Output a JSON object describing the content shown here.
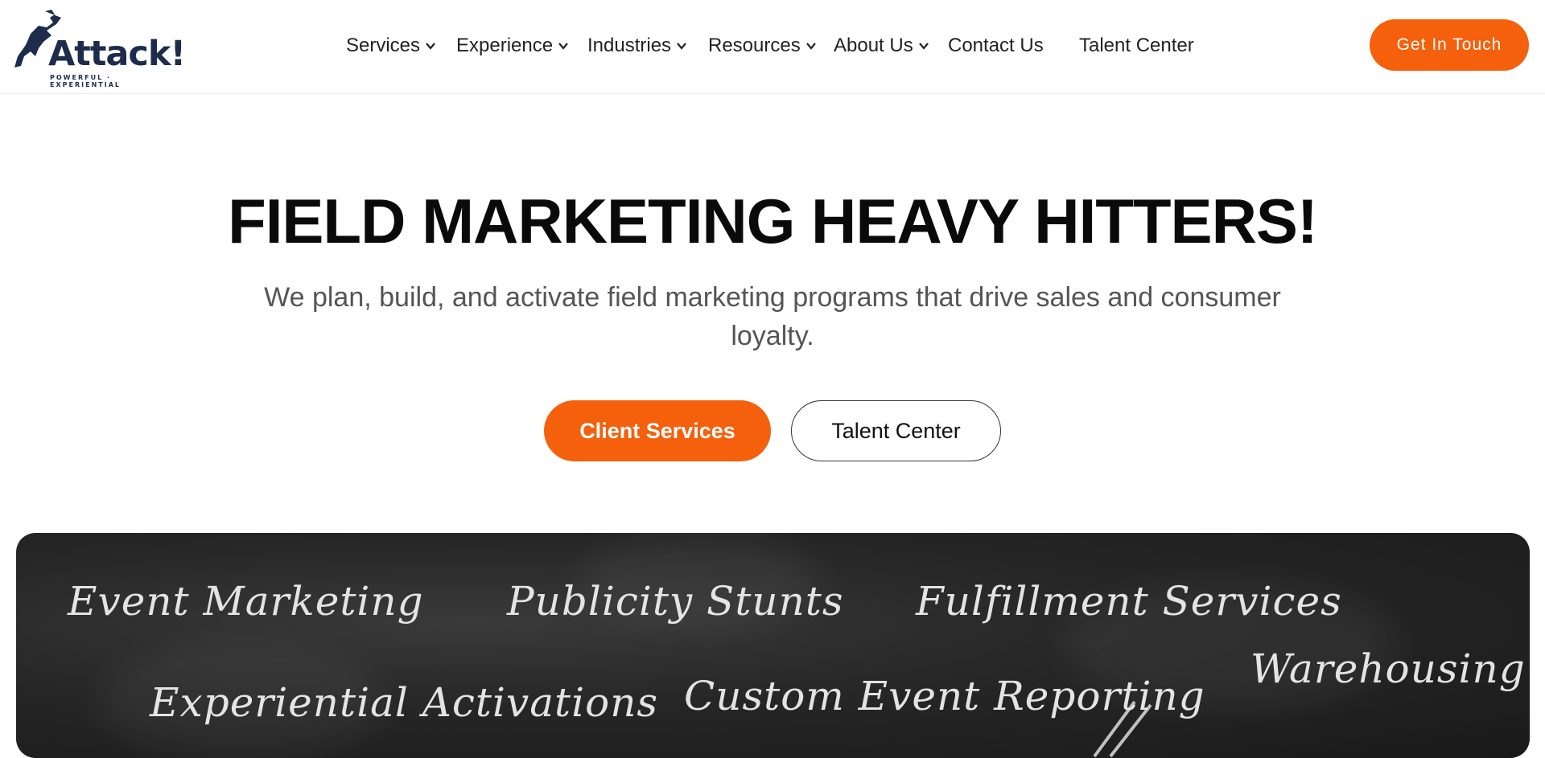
{
  "brand": {
    "name": "Attack!",
    "tagline": "POWERFUL · EXPERIENTIAL",
    "navy": "#1d2c4c",
    "accent": "#f4600c"
  },
  "nav": {
    "items": [
      {
        "label": "Services",
        "dropdown": true
      },
      {
        "label": "Experience",
        "dropdown": true
      },
      {
        "label": "Industries",
        "dropdown": true
      },
      {
        "label": "Resources",
        "dropdown": true
      },
      {
        "label": "About Us",
        "dropdown": true
      },
      {
        "label": "Contact Us",
        "dropdown": false
      },
      {
        "label": "Talent Center",
        "dropdown": false
      }
    ],
    "cta_label": "Get In Touch"
  },
  "hero": {
    "title": "FIELD MARKETING HEAVY HITTERS!",
    "subtitle": "We plan, build, and activate field marketing programs that drive sales and consumer loyalty.",
    "primary_button": "Client Services",
    "secondary_button": "Talent Center"
  },
  "chalkboard": {
    "phrases": [
      "Event Marketing",
      "Publicity Stunts",
      "Fulfillment Services",
      "Warehousing",
      "Experiential Activations",
      "Custom Event Reporting"
    ]
  }
}
